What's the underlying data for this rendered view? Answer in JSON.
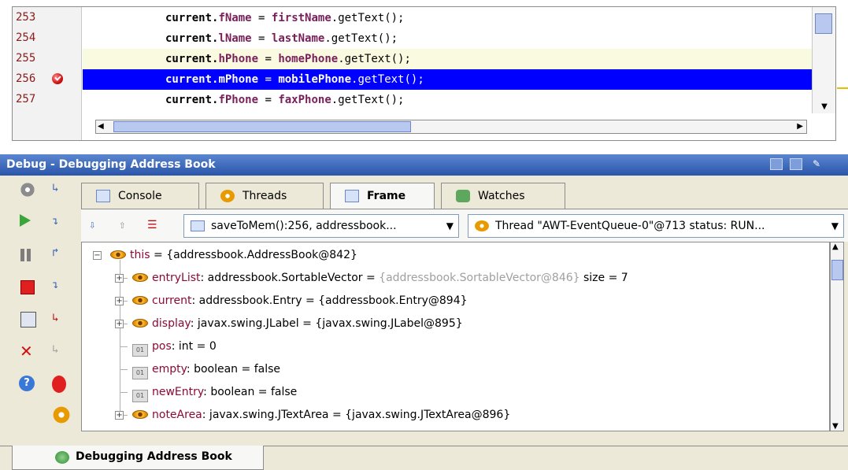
{
  "editor": {
    "lines": [
      {
        "num": "253",
        "obj": "current",
        "field": "fName",
        "src": "firstName",
        "call": ".getText();",
        "highlight": "none",
        "breakpoint": false
      },
      {
        "num": "254",
        "obj": "current",
        "field": "lName",
        "src": "lastName",
        "call": ".getText();",
        "highlight": "none",
        "breakpoint": false
      },
      {
        "num": "255",
        "obj": "current",
        "field": "hPhone",
        "src": "homePhone",
        "call": ".getText();",
        "highlight": "yellow",
        "breakpoint": false
      },
      {
        "num": "256",
        "obj": "current",
        "field": "mPhone",
        "src": "mobilePhone",
        "call": ".getText();",
        "highlight": "blue",
        "breakpoint": true
      },
      {
        "num": "257",
        "obj": "current",
        "field": "fPhone",
        "src": "faxPhone",
        "call": ".getText();",
        "highlight": "none",
        "breakpoint": false
      }
    ]
  },
  "debug": {
    "title": "Debug - Debugging Address Book",
    "tabs": [
      {
        "label": "Console",
        "icon": "console-icon",
        "active": false
      },
      {
        "label": "Threads",
        "icon": "threads-icon",
        "active": false
      },
      {
        "label": "Frame",
        "icon": "frame-icon",
        "active": true
      },
      {
        "label": "Watches",
        "icon": "watches-icon",
        "active": false
      }
    ],
    "frame_combo": "saveToMem():256, addressbook...",
    "thread_combo": "Thread \"AWT-EventQueue-0\"@713 status: RUN...",
    "tree": [
      {
        "name": "this",
        "type": " = ",
        "value": "{addressbook.AddressBook@842}",
        "extra": "",
        "kind": "object",
        "expander": "minus",
        "level": 0
      },
      {
        "name": "entryList",
        "type": ": addressbook.SortableVector = ",
        "value": "",
        "gray": "{addressbook.SortableVector@846}",
        "extra": " size = 7",
        "kind": "object",
        "expander": "plus",
        "level": 1
      },
      {
        "name": "current",
        "type": ": addressbook.Entry = ",
        "value": "{addressbook.Entry@894}",
        "extra": "",
        "kind": "object",
        "expander": "plus",
        "level": 1
      },
      {
        "name": "display",
        "type": ": javax.swing.JLabel = ",
        "value": "{javax.swing.JLabel@895}",
        "extra": "",
        "kind": "object",
        "expander": "plus",
        "level": 1
      },
      {
        "name": "pos",
        "type": ": int = ",
        "value": "0",
        "extra": "",
        "kind": "primitive",
        "expander": "none",
        "level": 1
      },
      {
        "name": "empty",
        "type": ": boolean = ",
        "value": "false",
        "extra": "",
        "kind": "primitive",
        "expander": "none",
        "level": 1
      },
      {
        "name": "newEntry",
        "type": ": boolean = ",
        "value": "false",
        "extra": "",
        "kind": "primitive",
        "expander": "none",
        "level": 1
      },
      {
        "name": "noteArea",
        "type": ": javax.swing.JTextArea = ",
        "value": "{javax.swing.JTextArea@896}",
        "extra": "",
        "kind": "object",
        "expander": "plus",
        "level": 1
      }
    ]
  },
  "bottom_tab": "Debugging Address Book",
  "colors": {
    "title_bar": "#2a55aa",
    "current_line": "#0000ff",
    "exec_line": "#fafae1",
    "var_name": "#8b0a36"
  }
}
